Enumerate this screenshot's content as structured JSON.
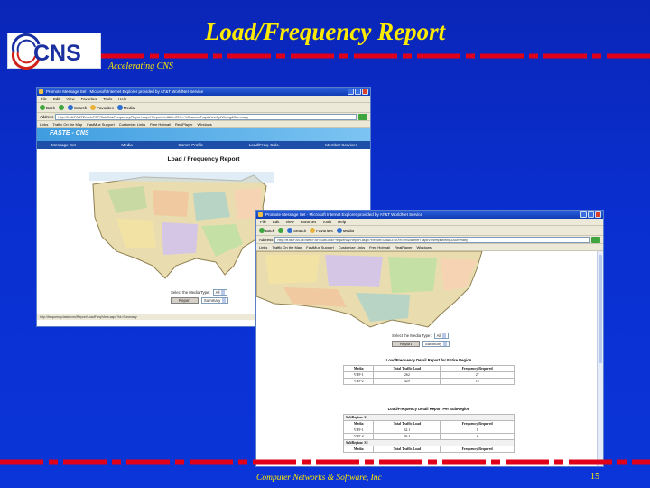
{
  "slide": {
    "title": "Load/Frequency Report",
    "tagline": "Accelerating CNS",
    "footer": "Computer Networks & Software, Inc",
    "page_number": "15",
    "logo_text": "CNS",
    "colors": {
      "background": "#0a2fd0",
      "title": "#ffeb00",
      "stripe": "#e0001a"
    }
  },
  "back_window": {
    "title": "Promote Message Set - Microsoft Internet Explorer provided by AT&T WorldNet Service",
    "menu": [
      "File",
      "Edit",
      "View",
      "Favorites",
      "Tools",
      "Help"
    ],
    "toolbar": {
      "back": "Back",
      "search": "Search",
      "favorites": "Favorites",
      "media": "Media"
    },
    "address_label": "Address",
    "address": "http://ff.fdf/FASTE/web/FAF/SubGrid/Frequency/Report.aspx?Report=Ld&ID=20%=%ScannerTrap#ViewRptWiring&Summary",
    "go": "Go",
    "links_label": "Links",
    "links": [
      "Traffic On the Map",
      "FastMux Support",
      "Customize Links",
      "Free Hotmail",
      "RealPlayer",
      "Windows"
    ],
    "app_name": "FASTE - CNS",
    "nav": [
      "Message Set",
      "Media",
      "Comm Profile",
      "Load/Freq. Calc.",
      "Member Services"
    ],
    "page_heading": "Load / Frequency Report",
    "media_label": "Select the Media Type:",
    "media_value": "All",
    "report_button": "Report",
    "report_mode": "Summary",
    "status": "http://frequency.faste.cns/Report/LoadFreq/View.aspx?Id=Summary"
  },
  "front_window": {
    "title": "Promote Message Set - Microsoft Internet Explorer provided by AT&T WorldNet Service",
    "menu": [
      "File",
      "Edit",
      "View",
      "Favorites",
      "Tools",
      "Help"
    ],
    "toolbar": {
      "back": "Back",
      "search": "Search",
      "favorites": "Favorites",
      "media": "Media"
    },
    "address_label": "Address",
    "address": "http://ff.fdf/FASTE/web/FAF/SubGrid/Frequency/Report.aspx?Report=Ld&ID=20%=%ScannerTrap#ViewRptWiring&Summary",
    "go": "Go",
    "links_label": "Links",
    "links": [
      "Traffic On the Map",
      "FastMux Support",
      "Customize Links",
      "Free Hotmail",
      "RealPlayer",
      "Windows"
    ],
    "media_label": "Select the Media Type:",
    "media_value": "All",
    "report_button": "Report",
    "report_mode": "Summary",
    "summary_table": {
      "title": "Load/Frequency Detail Report for Entire Region",
      "headers": [
        "Media",
        "Total Traffic Load",
        "Frequency Required"
      ],
      "rows": [
        [
          "VHF-1",
          "262",
          "27"
        ],
        [
          "VHF-2",
          "429",
          "15"
        ]
      ]
    },
    "subregion_table": {
      "title": "Load/Frequency Detail Report Per SubRegion",
      "headers": [
        "Media",
        "Total Traffic Load",
        "Frequency Required"
      ],
      "groups": [
        {
          "name": "SubRegion: S1",
          "rows": [
            [
              "VHF-1",
              "62.1",
              "1"
            ],
            [
              "VHF-2",
              "35.1",
              "2"
            ]
          ]
        },
        {
          "name": "SubRegion: S2",
          "rows": []
        }
      ]
    }
  }
}
